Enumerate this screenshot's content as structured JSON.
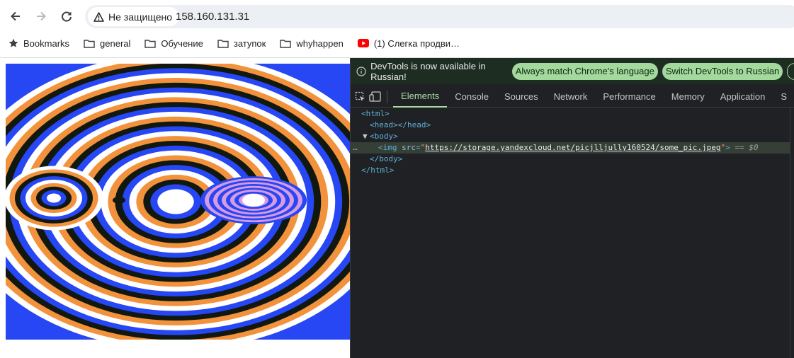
{
  "browser": {
    "security_label": "Не защищено",
    "url": "158.160.131.31",
    "bookmarks": [
      {
        "label": "Bookmarks",
        "icon": "star-icon"
      },
      {
        "label": "general",
        "icon": "folder-icon"
      },
      {
        "label": "Обучение",
        "icon": "folder-icon"
      },
      {
        "label": "затупок",
        "icon": "folder-icon"
      },
      {
        "label": "whyhappen",
        "icon": "folder-icon"
      },
      {
        "label": "(1) Слегка продви…",
        "icon": "youtube-icon"
      }
    ]
  },
  "page": {
    "image_alt": "optical illusion image",
    "image_colors": [
      "#2747f4",
      "#f2923c",
      "#ffffff",
      "#11180f",
      "#d99be0"
    ]
  },
  "devtools": {
    "infobar_message": "DevTools is now available in Russian!",
    "infobar_buttons": [
      "Always match Chrome's language",
      "Switch DevTools to Russian"
    ],
    "tabs": [
      "Elements",
      "Console",
      "Sources",
      "Network",
      "Performance",
      "Memory",
      "Application",
      "S"
    ],
    "active_tab": "Elements",
    "dom": {
      "html_open": "<html>",
      "head_line": "<head></head>",
      "body_open": "<body>",
      "img_open": "<img ",
      "img_attr": "src",
      "img_src": "https://storage.yandexcloud.net/picjlljully160524/some_pic.jpeg",
      "img_suffix": " == $0",
      "body_close": "</body>",
      "html_close": "</html>",
      "ellipsis": "…"
    }
  }
}
